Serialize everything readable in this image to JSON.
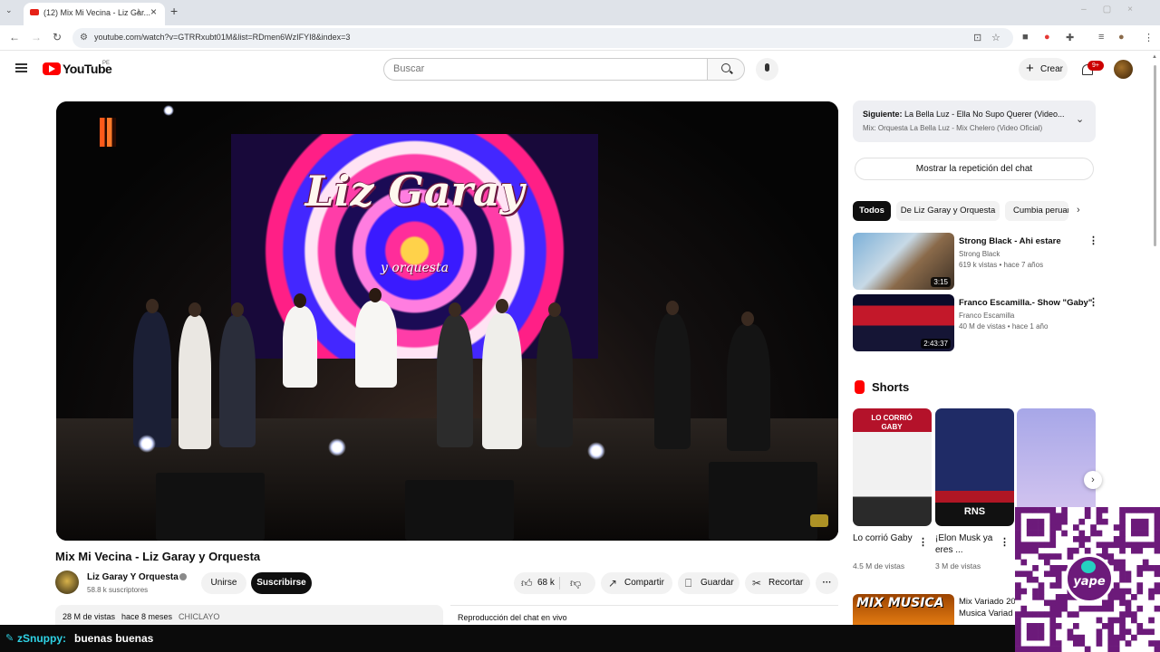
{
  "browser": {
    "tab_title": "(12) Mix Mi Vecina - Liz Gar...",
    "url": "youtube.com/watch?v=GTRRxubt01M&list=RDmen6WzIFYI8&index=3"
  },
  "header": {
    "logo_text": "YouTube",
    "country": "PE",
    "search_placeholder": "Buscar",
    "create_label": "Crear",
    "notif_count": "9+"
  },
  "video": {
    "screen_title": "Liz Garay",
    "screen_subtitle": "y orquesta",
    "title": "Mix Mi Vecina - Liz Garay y Orquesta",
    "channel": "Liz Garay Y Orquesta",
    "subscribers": "58.8 k suscriptores",
    "join_label": "Unirse",
    "subscribe_label": "Suscribirse",
    "likes": "68 k",
    "share_label": "Compartir",
    "save_label": "Guardar",
    "clip_label": "Recortar",
    "more_label": "···",
    "views": "28 M de vistas",
    "age": "hace 8 meses",
    "location": "CHICLAYO",
    "chat_replay_below": "Reproducción del chat en vivo"
  },
  "sidebar": {
    "next_prefix": "Siguiente:",
    "next_title": "La Bella Luz - Ella No Supo Querer (Video...",
    "next_playlist": "Mix: Orquesta La Bella Luz - Mix Chelero (Video Oficial)",
    "chat_replay": "Mostrar la repetición del chat",
    "chips": [
      "Todos",
      "De Liz Garay y Orquesta",
      "Cumbia peruana"
    ],
    "recs": [
      {
        "title": "Strong Black - Ahi estare",
        "channel": "Strong Black",
        "meta": "619 k vistas • hace 7 años",
        "duration": "3:15"
      },
      {
        "title": "Franco Escamilla.- Show \"Gaby\"",
        "channel": "Franco Escamilla",
        "meta": "40 M de vistas • hace 1 año",
        "duration": "2:43:37"
      }
    ],
    "shorts_title": "Shorts",
    "shorts": [
      {
        "title": "Lo corrió Gaby",
        "views": "4.5 M de vistas",
        "thumb_text": "LO CORRIÓ GABY"
      },
      {
        "title": "¡Elon Musk ya eres ...",
        "views": "3 M de vistas",
        "thumb_text": "RNS"
      },
      {
        "title": "",
        "views": "",
        "thumb_text": ""
      }
    ],
    "rec_bottom": {
      "title": "Mix Variado 20",
      "title2": "Musica Variad",
      "thumb_text": "MIX MUSICA"
    }
  },
  "overlay": {
    "chat_user": "zSnuppy:",
    "chat_message": "buenas buenas",
    "yape_label": "yape"
  },
  "colors": {
    "brand_red": "#ff0000",
    "yape_purple": "#6c1a7a",
    "chat_user": "#2fd3e6"
  }
}
